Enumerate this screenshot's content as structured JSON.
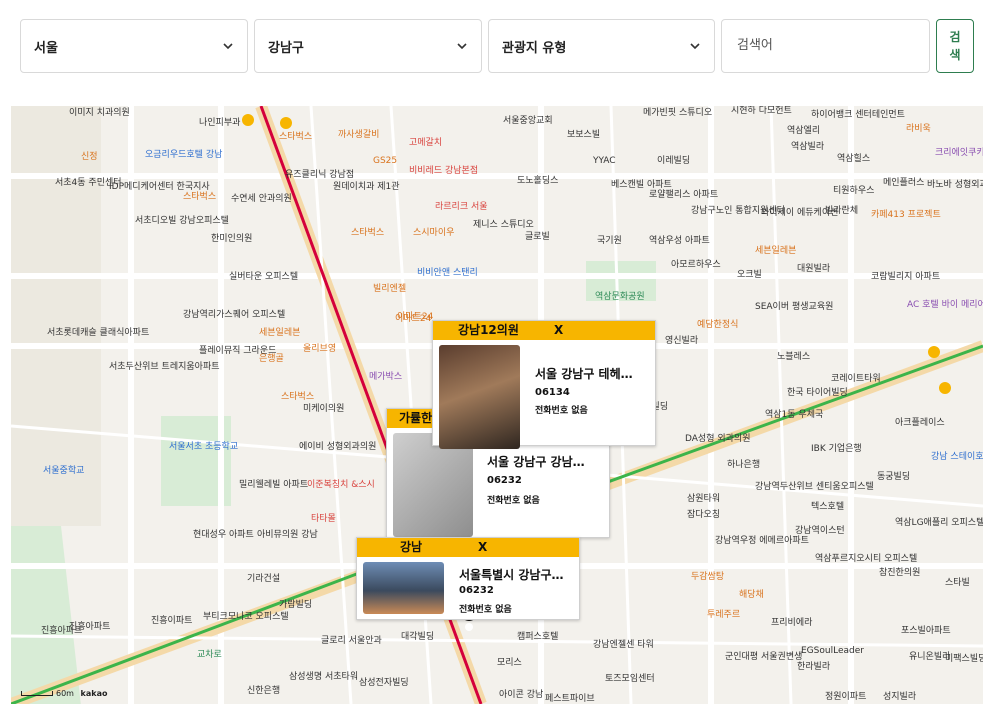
{
  "filters": {
    "region": "서울",
    "district": "강남구",
    "type": "관광지 유형",
    "search_placeholder": "검색어",
    "search_button": "검\n색"
  },
  "map": {
    "scale_label": "60m",
    "provider": "kakao",
    "labels": [
      "이미지 치과의원",
      "나인피부과",
      "스타벅스",
      "까사생갈비",
      "서울중앙교회",
      "보보스빌",
      "메가빈핏 스튜디오",
      "시현하 다모헌트",
      "하이어뱅크 센터테인먼트",
      "라비욱",
      "오금리우드호텔 강남",
      "신정",
      "서초4동 주민센터",
      "IDP메디케어센터 한국지사",
      "스타벅스",
      "수연세 안과의원",
      "유즈클리닉 강남점",
      "원데이치과 제1관",
      "GS25",
      "고메갈치",
      "비비레드 강남본점",
      "라르리크 서울",
      "도노홀딩스",
      "YYAC",
      "베스캔빌 아파트",
      "로얄팰리스 아파트",
      "이레빌딩",
      "역삼엘리",
      "역삼빌라",
      "역삼힐스",
      "크리에잇쿠키",
      "메인플러스",
      "바노바 성형외과",
      "티원하우스",
      "카페413 프로젝트",
      "서초디오빌 강남오피스텔",
      "한미인의원",
      "스타벅스",
      "스시마이우",
      "제니스 스튜디오",
      "글로빌",
      "강남구노인 통합지원센터",
      "와이제이 에듀케이션",
      "빌라란체",
      "역삼우성 아파트",
      "국기원",
      "세븐일레븐",
      "실버타운 오피스텔",
      "비비안앤 스탠리",
      "빌리엔젤",
      "이마트24",
      "역삼문화공원",
      "아모르하우스",
      "오크빌",
      "대원빌라",
      "코람빌리지 아파트",
      "서초롯데캐슬 클래식아파트",
      "강남역리가스퀘어 오피스텔",
      "세븐일레븐",
      "올리브영",
      "이마트24",
      "영신빌라",
      "예담한정식",
      "SEA이버 평생교육원",
      "AC 호텔 바이 메리어트 서울 강남",
      "서초두산위브 트레지움아파트",
      "플레이뮤직 그라운드",
      "은행골",
      "메가박스",
      "스타벅스",
      "미케이의원",
      "노블레스",
      "코레이트타워",
      "현대빌딩",
      "역삼1동 우체국",
      "에이비 성형외과의원",
      "아크플레이스",
      "서울서초 초등학교",
      "서울중학교",
      "밀리웰레빌 아파트",
      "이준복칭치 &스시",
      "DA성형 외과의원",
      "하나은행",
      "IBK 기업은행",
      "동궁빌딩",
      "한국 타이어빌딩",
      "강남 스테이호텔",
      "타타몰",
      "현대성우 아파트",
      "아비뮤의원 강남",
      "강남역두산위브 센티움오피스텔",
      "텍스호텔",
      "역삼LG애플리 오피스텔",
      "진흥아파트",
      "기라건설",
      "가람빌딩",
      "부티크모나코 오피스텔",
      "삼원타워",
      "잠다오칭",
      "강남역우정 에메르아파트",
      "강남역이스턴",
      "역삼푸르지오시티 오피스텔",
      "참진한의원",
      "스타빌",
      "진흥이파트",
      "진흥아파트",
      "교차로",
      "두감쌈탕",
      "해당채",
      "투레주르",
      "프리비에라",
      "포스빌아파트",
      "EGSoulLeader",
      "한라빌라",
      "정원이파트",
      "성지빌라",
      "유니온빌라",
      "삼성생명 서초타워",
      "글로리 서울안과",
      "삼성전자빌딩",
      "신한은행",
      "대각빌딩",
      "캠퍼스호텔",
      "강남엔젤센 타워",
      "모리스",
      "토즈모임센터",
      "아이콘 강남",
      "페스트파이브",
      "군인대평 서울권변생",
      "미팩스빌딩"
    ]
  },
  "cards": [
    {
      "name": "강남12의원",
      "close": "X",
      "address": "서울 강남구 테헤…",
      "zip": "06134",
      "phone": "전화번호 없음"
    },
    {
      "name": "가률한",
      "close": "X",
      "address": "서울 강남구 강남…",
      "zip": "06232",
      "phone": "전화번호 없음"
    },
    {
      "name": "강남",
      "close": "X",
      "address": "서울특별시 강남구…",
      "zip": "06232",
      "phone": "전화번호 없음"
    }
  ],
  "colors": {
    "accent": "#f7b500",
    "button_green": "#2e7d4f",
    "line2_green": "#3cb44a",
    "sinbundang_red": "#d4003b"
  }
}
